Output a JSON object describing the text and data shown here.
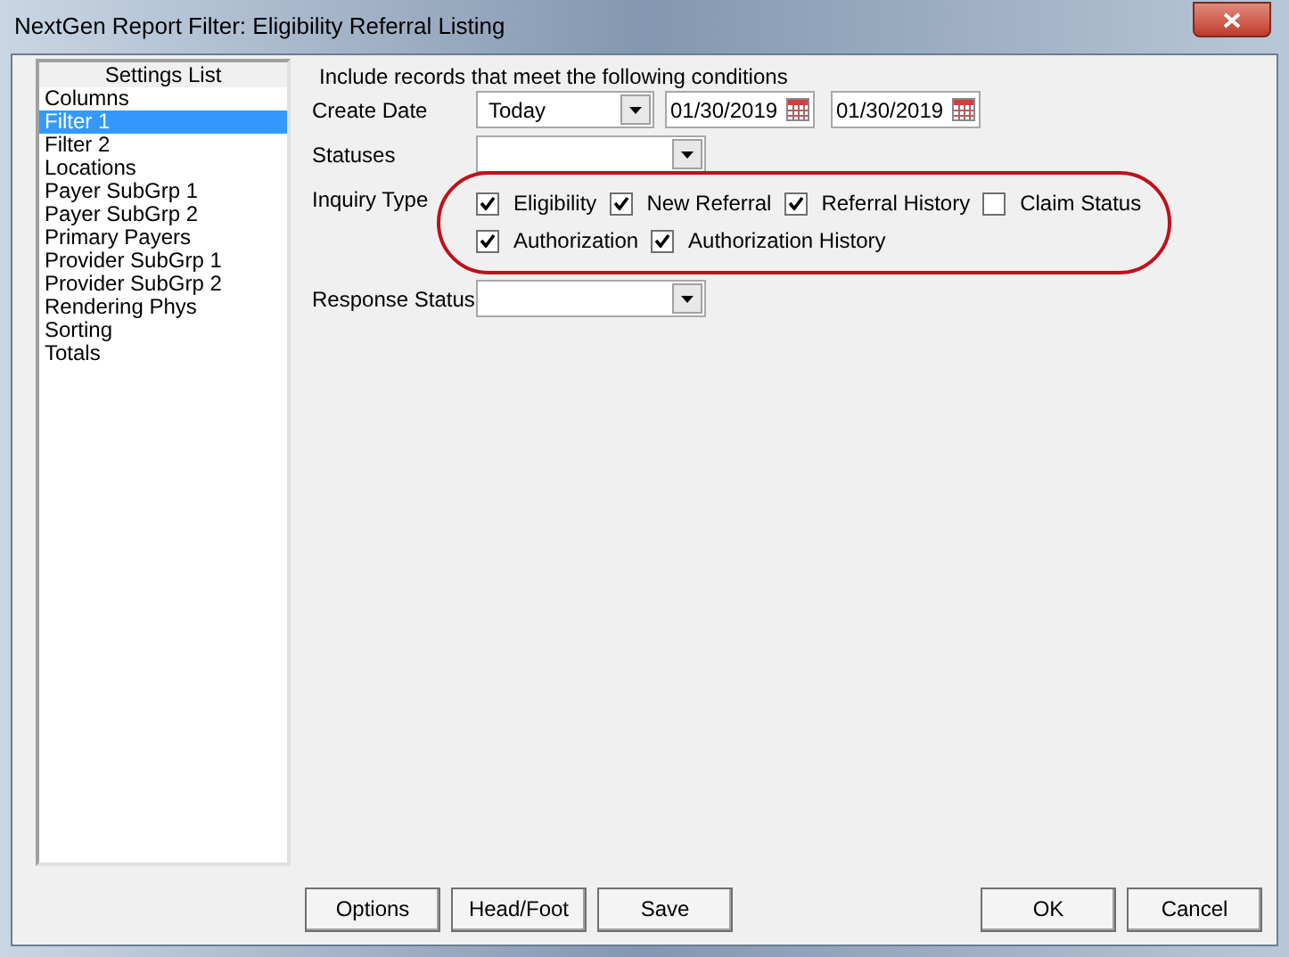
{
  "window": {
    "title": "NextGen Report Filter: Eligibility Referral Listing"
  },
  "settings_list": {
    "header": "Settings List",
    "items": [
      {
        "label": "Columns",
        "selected": false
      },
      {
        "label": "Filter 1",
        "selected": true
      },
      {
        "label": "Filter 2",
        "selected": false
      },
      {
        "label": "Locations",
        "selected": false
      },
      {
        "label": "Payer SubGrp 1",
        "selected": false
      },
      {
        "label": "Payer SubGrp 2",
        "selected": false
      },
      {
        "label": "Primary Payers",
        "selected": false
      },
      {
        "label": "Provider SubGrp 1",
        "selected": false
      },
      {
        "label": "Provider SubGrp 2",
        "selected": false
      },
      {
        "label": "Rendering Phys",
        "selected": false
      },
      {
        "label": "Sorting",
        "selected": false
      },
      {
        "label": "Totals",
        "selected": false
      }
    ]
  },
  "conditions": {
    "heading": "Include records that meet the following conditions",
    "create_date": {
      "label": "Create Date",
      "value": "Today",
      "from": "01/30/2019",
      "to": "01/30/2019"
    },
    "statuses": {
      "label": "Statuses"
    },
    "inquiry_type": {
      "label": "Inquiry Type",
      "rows": [
        [
          {
            "label": "Eligibility",
            "checked": true
          },
          {
            "label": "New Referral",
            "checked": true
          },
          {
            "label": "Referral History",
            "checked": true
          },
          {
            "label": "Claim Status",
            "checked": false
          }
        ],
        [
          {
            "label": "Authorization",
            "checked": true
          },
          {
            "label": "Authorization History",
            "checked": true
          }
        ]
      ]
    },
    "response_status": {
      "label": "Response Status"
    }
  },
  "buttons_left": [
    "Options",
    "Head/Foot",
    "Save"
  ],
  "buttons_right": [
    "OK",
    "Cancel"
  ]
}
